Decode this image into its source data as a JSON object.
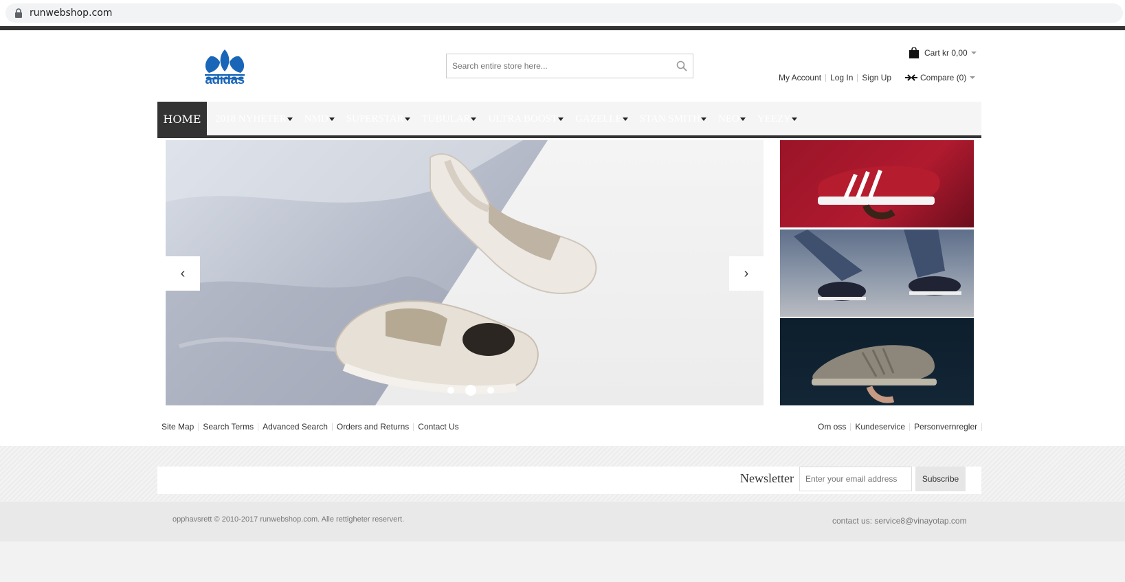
{
  "browser": {
    "url": "runwebshop.com"
  },
  "header": {
    "logo_text": "adidas",
    "search_placeholder": "Search entire store here...",
    "cart_label": "Cart kr 0,00",
    "account_links": [
      "My Account",
      "Log In",
      "Sign Up"
    ],
    "compare_label": "Compare (0)"
  },
  "nav": {
    "home": "HOME",
    "items": [
      "2018 NYHETER",
      "NMD",
      "SUPERSTAR",
      "TUBULAR",
      "ULTRA BOOST",
      "GAZELLE",
      "STAN SMITH",
      "NEO",
      "YEEZY"
    ]
  },
  "slider": {
    "prev": "‹",
    "next": "›",
    "dot_count": 3,
    "active_dot": 2
  },
  "footer": {
    "links_left": [
      "Site Map",
      "Search Terms",
      "Advanced Search",
      "Orders and Returns",
      "Contact Us"
    ],
    "links_right": [
      "Om oss",
      "Kundeservice",
      "Personvernregler"
    ]
  },
  "newsletter": {
    "title": "Newsletter",
    "placeholder": "Enter your email address",
    "button": "Subscribe"
  },
  "bottom": {
    "copyright": "opphavsrett © 2010-2017 runwebshop.com. Alle rettigheter reservert.",
    "contact": "contact us: service8@vinayotap.com"
  },
  "colors": {
    "brand_blue": "#1966b8",
    "nav_dark": "#333333"
  }
}
